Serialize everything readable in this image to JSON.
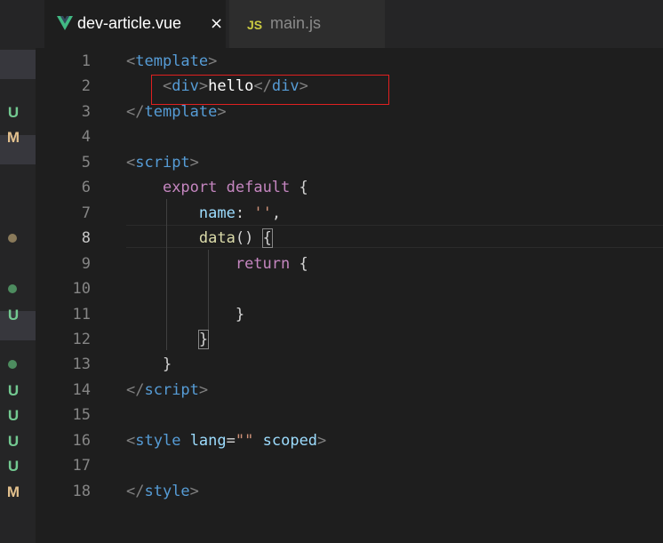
{
  "tabs": [
    {
      "icon": "vue-icon",
      "label": "dev-article.vue",
      "close": "×",
      "active": true
    },
    {
      "icon": "js-icon",
      "icon_text": "JS",
      "label": "main.js",
      "active": false
    }
  ],
  "git_markers": [
    {
      "row": 3,
      "type": "letter",
      "text": "U",
      "color": "#73c991"
    },
    {
      "row": 4,
      "type": "letter",
      "text": "M",
      "color": "#e2c08d"
    },
    {
      "row": 8,
      "type": "dot",
      "color": "#8a7a5a"
    },
    {
      "row": 10,
      "type": "dot",
      "color": "#4d8c5f"
    },
    {
      "row": 11,
      "type": "letter",
      "text": "U",
      "color": "#73c991"
    },
    {
      "row": 13,
      "type": "dot",
      "color": "#4d8c5f"
    },
    {
      "row": 14,
      "type": "letter",
      "text": "U",
      "color": "#73c991"
    },
    {
      "row": 15,
      "type": "letter",
      "text": "U",
      "color": "#73c991"
    },
    {
      "row": 16,
      "type": "letter",
      "text": "U",
      "color": "#73c991"
    },
    {
      "row": 17,
      "type": "letter",
      "text": "U",
      "color": "#73c991"
    },
    {
      "row": 18,
      "type": "letter",
      "text": "M",
      "color": "#e2c08d"
    }
  ],
  "editor": {
    "current_line": 8,
    "lines": [
      {
        "n": "1",
        "tokens": [
          [
            "<",
            "tk-tag-br"
          ],
          [
            "template",
            "tk-tag"
          ],
          [
            ">",
            "tk-tag-br"
          ]
        ]
      },
      {
        "n": "2",
        "tokens": [
          [
            "    ",
            ""
          ],
          [
            "<",
            "tk-tag-br"
          ],
          [
            "div",
            "tk-tag"
          ],
          [
            ">",
            "tk-tag-br"
          ],
          [
            "hello",
            "tk-txt"
          ],
          [
            "</",
            "tk-tag-br"
          ],
          [
            "div",
            "tk-tag"
          ],
          [
            ">",
            "tk-tag-br"
          ]
        ]
      },
      {
        "n": "3",
        "tokens": [
          [
            "</",
            "tk-tag-br"
          ],
          [
            "template",
            "tk-tag"
          ],
          [
            ">",
            "tk-tag-br"
          ]
        ]
      },
      {
        "n": "4",
        "tokens": []
      },
      {
        "n": "5",
        "tokens": [
          [
            "<",
            "tk-tag-br"
          ],
          [
            "script",
            "tk-tag"
          ],
          [
            ">",
            "tk-tag-br"
          ]
        ]
      },
      {
        "n": "6",
        "tokens": [
          [
            "    ",
            ""
          ],
          [
            "export",
            "tk-kw"
          ],
          [
            " ",
            ""
          ],
          [
            "default",
            "tk-kw"
          ],
          [
            " {",
            ""
          ]
        ]
      },
      {
        "n": "7",
        "tokens": [
          [
            "        ",
            ""
          ],
          [
            "name",
            "tk-prop"
          ],
          [
            ": ",
            ""
          ],
          [
            "''",
            "tk-str"
          ],
          [
            ",",
            ""
          ]
        ]
      },
      {
        "n": "8",
        "tokens": [
          [
            "        ",
            ""
          ],
          [
            "data",
            "tk-fn"
          ],
          [
            "() ",
            ""
          ],
          [
            "{",
            "bracket-match"
          ]
        ]
      },
      {
        "n": "9",
        "tokens": [
          [
            "            ",
            ""
          ],
          [
            "return",
            "tk-kw"
          ],
          [
            " {",
            ""
          ]
        ]
      },
      {
        "n": "10",
        "tokens": []
      },
      {
        "n": "11",
        "tokens": [
          [
            "            }",
            ""
          ]
        ]
      },
      {
        "n": "12",
        "tokens": [
          [
            "        ",
            ""
          ],
          [
            "}",
            "bracket-match"
          ]
        ]
      },
      {
        "n": "13",
        "tokens": [
          [
            "    }",
            ""
          ]
        ]
      },
      {
        "n": "14",
        "tokens": [
          [
            "</",
            "tk-tag-br"
          ],
          [
            "script",
            "tk-tag"
          ],
          [
            ">",
            "tk-tag-br"
          ]
        ]
      },
      {
        "n": "15",
        "tokens": []
      },
      {
        "n": "16",
        "tokens": [
          [
            "<",
            "tk-tag-br"
          ],
          [
            "style",
            "tk-tag"
          ],
          [
            " ",
            ""
          ],
          [
            "lang",
            "tk-attr"
          ],
          [
            "=",
            ""
          ],
          [
            "\"\"",
            "tk-str"
          ],
          [
            " ",
            ""
          ],
          [
            "scoped",
            "tk-attr"
          ],
          [
            ">",
            "tk-tag-br"
          ]
        ]
      },
      {
        "n": "17",
        "tokens": []
      },
      {
        "n": "18",
        "tokens": [
          [
            "</",
            "tk-tag-br"
          ],
          [
            "style",
            "tk-tag"
          ],
          [
            ">",
            "tk-tag-br"
          ]
        ]
      }
    ]
  },
  "colors": {
    "vue_green": "#41b883",
    "js_yellow": "#cbcb41",
    "annotation_red": "#e02020"
  }
}
